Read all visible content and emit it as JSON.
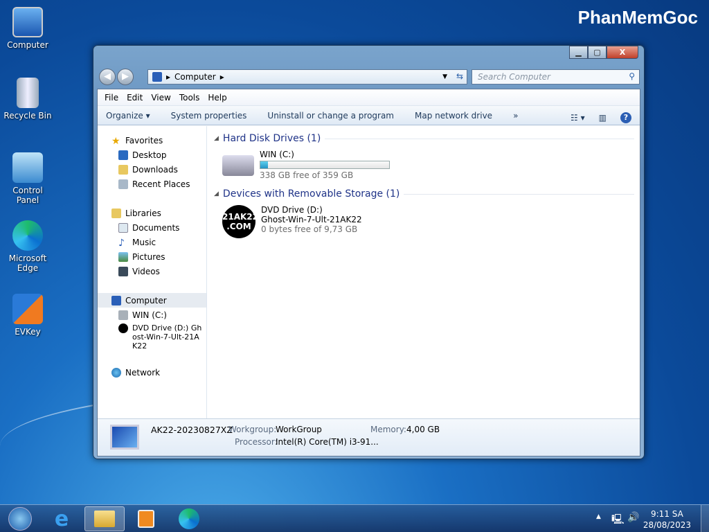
{
  "watermark": "PhanMemGoc",
  "desktop": {
    "icons": [
      {
        "label": "Computer"
      },
      {
        "label": "Recycle Bin"
      },
      {
        "label": "Control Panel"
      },
      {
        "label": "Microsoft Edge"
      },
      {
        "label": "EVKey"
      }
    ]
  },
  "window": {
    "address": {
      "path": "Computer",
      "search_placeholder": "Search Computer"
    },
    "menu": [
      "File",
      "Edit",
      "View",
      "Tools",
      "Help"
    ],
    "toolbar": {
      "organize": "Organize ▾",
      "items": [
        "System properties",
        "Uninstall or change a program",
        "Map network drive",
        "»"
      ]
    },
    "nav": {
      "favorites": "Favorites",
      "fav_items": [
        "Desktop",
        "Downloads",
        "Recent Places"
      ],
      "libraries": "Libraries",
      "lib_items": [
        "Documents",
        "Music",
        "Pictures",
        "Videos"
      ],
      "computer": "Computer",
      "comp_items": [
        "WIN (C:)",
        "DVD Drive (D:) Ghost-Win-7-Ult-21AK22"
      ],
      "network": "Network"
    },
    "groups": [
      {
        "title": "Hard Disk Drives (1)",
        "name": "WIN (C:)",
        "usage_percent": 6,
        "free": "338 GB free of 359 GB"
      },
      {
        "title": "Devices with Removable Storage (1)",
        "name": "DVD Drive (D:)",
        "label": "Ghost-Win-7-Ult-21AK22",
        "free": "0 bytes free of 9,73 GB",
        "logo": "21AK22 .COM"
      }
    ],
    "details": {
      "computer_name": "AK22-20230827XZ",
      "workgroup_label": "Workgroup:",
      "workgroup": "WorkGroup",
      "memory_label": "Memory:",
      "memory": "4,00 GB",
      "processor_label": "Processor:",
      "processor": "Intel(R) Core(TM) i3-91..."
    }
  },
  "taskbar": {
    "time": "9:11 SA",
    "date": "28/08/2023"
  }
}
